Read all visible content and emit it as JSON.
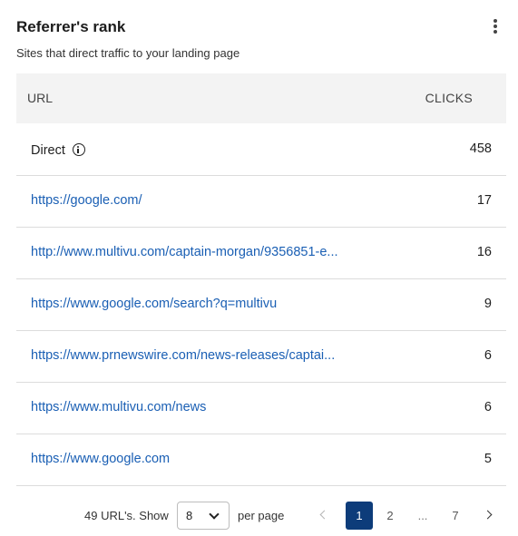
{
  "card": {
    "title": "Referrer's rank",
    "subtitle": "Sites that direct traffic to your landing page",
    "menu_icon": "more-vertical-icon"
  },
  "table": {
    "headers": {
      "url": "URL",
      "clicks": "CLICKS"
    },
    "rows": [
      {
        "url": "Direct",
        "clicks": "458",
        "is_link": false,
        "has_info": true
      },
      {
        "url": "https://google.com/",
        "clicks": "17",
        "is_link": true
      },
      {
        "url": "http://www.multivu.com/captain-morgan/9356851-e...",
        "clicks": "16",
        "is_link": true
      },
      {
        "url": "https://www.google.com/search?q=multivu",
        "clicks": "9",
        "is_link": true
      },
      {
        "url": "https://www.prnewswire.com/news-releases/captai...",
        "clicks": "6",
        "is_link": true
      },
      {
        "url": "https://www.multivu.com/news",
        "clicks": "6",
        "is_link": true
      },
      {
        "url": "https://www.google.com",
        "clicks": "5",
        "is_link": true
      }
    ]
  },
  "pagination": {
    "count_text": "49 URL's. Show",
    "per_page_value": "8",
    "per_page_suffix": "per page",
    "pages": [
      "1",
      "2",
      "...",
      "7"
    ],
    "current_page": "1",
    "prev_icon": "chevron-left-icon",
    "next_icon": "chevron-right-icon"
  },
  "colors": {
    "link": "#1a5fb4",
    "header_bg": "#f3f3f3",
    "active_page_bg": "#0d3c7a"
  }
}
